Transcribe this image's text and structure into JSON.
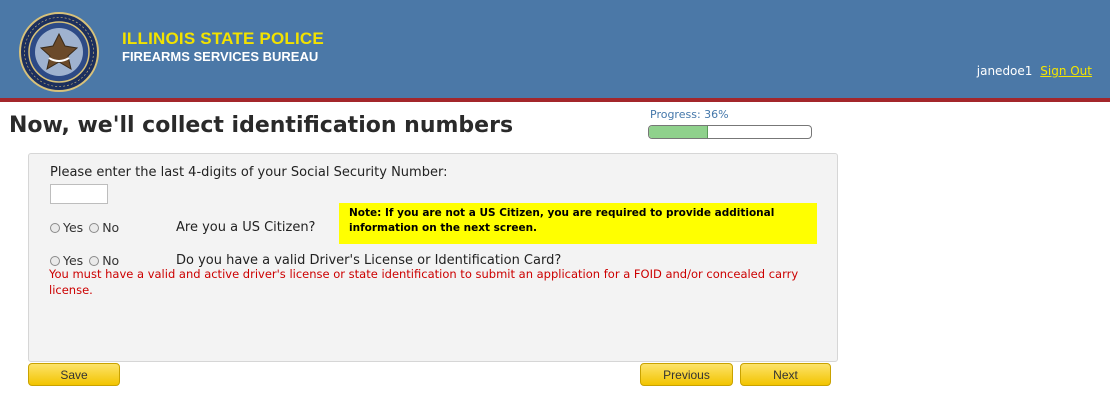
{
  "header": {
    "agency_name": "ILLINOIS STATE POLICE",
    "bureau_name": "FIREARMS SERVICES BUREAU",
    "seal_text": "ILLINOIS STATE POLICE",
    "username": "janedoe1",
    "sign_out_label": "Sign Out"
  },
  "page": {
    "title": "Now, we'll collect identification numbers"
  },
  "progress": {
    "label": "Progress: 36%",
    "percent": 36
  },
  "form": {
    "ssn_label": "Please enter the last 4-digits of your Social Security Number:",
    "ssn_value": "",
    "yes_label": "Yes",
    "no_label": "No",
    "citizen_question": "Are you a US Citizen?",
    "citizen_note": "Note: If you are not a US Citizen, you are required to provide additional information on the next screen.",
    "license_question": "Do you have a valid Driver's License or Identification Card?",
    "license_warning": "You must have a valid and active driver's license or state identification to submit an application for a FOID and/or concealed carry license."
  },
  "buttons": {
    "save": "Save",
    "previous": "Previous",
    "next": "Next"
  },
  "colors": {
    "header_bg": "#4b78a7",
    "accent_rule": "#a3262b",
    "agency_yellow": "#f2e200",
    "note_bg": "#ffff00",
    "warning_red": "#cc0000",
    "button_yellow": "#f2c400",
    "progress_fill": "#8fd18c"
  }
}
